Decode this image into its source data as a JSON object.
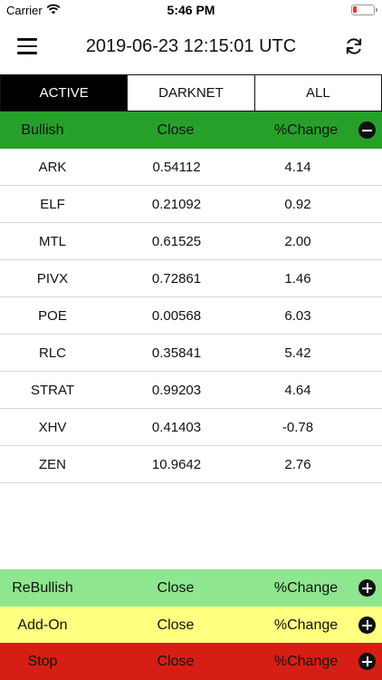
{
  "status_bar": {
    "carrier": "Carrier",
    "time": "5:46 PM"
  },
  "nav": {
    "title": "2019-06-23 12:15:01 UTC"
  },
  "tabs": [
    {
      "label": "ACTIVE",
      "active": true
    },
    {
      "label": "DARKNET",
      "active": false
    },
    {
      "label": "ALL",
      "active": false
    }
  ],
  "colors": {
    "bullish": "#27a02a",
    "rebullish": "#8ee68e",
    "addon": "#ffff80",
    "stop": "#d61e14"
  },
  "sections": {
    "bullish": {
      "label": "Bullish",
      "close": "Close",
      "change": "%Change"
    },
    "rebullish": {
      "label": "ReBullish",
      "close": "Close",
      "change": "%Change"
    },
    "addon": {
      "label": "Add-On",
      "close": "Close",
      "change": "%Change"
    },
    "stop": {
      "label": "Stop",
      "close": "Close",
      "change": "%Change"
    }
  },
  "bullish_rows": [
    {
      "symbol": "ARK",
      "close": "0.54112",
      "change": "4.14"
    },
    {
      "symbol": "ELF",
      "close": "0.21092",
      "change": "0.92"
    },
    {
      "symbol": "MTL",
      "close": "0.61525",
      "change": "2.00"
    },
    {
      "symbol": "PIVX",
      "close": "0.72861",
      "change": "1.46"
    },
    {
      "symbol": "POE",
      "close": "0.00568",
      "change": "6.03"
    },
    {
      "symbol": "RLC",
      "close": "0.35841",
      "change": "5.42"
    },
    {
      "symbol": "STRAT",
      "close": "0.99203",
      "change": "4.64"
    },
    {
      "symbol": "XHV",
      "close": "0.41403",
      "change": "-0.78"
    },
    {
      "symbol": "ZEN",
      "close": "10.9642",
      "change": "2.76"
    }
  ]
}
